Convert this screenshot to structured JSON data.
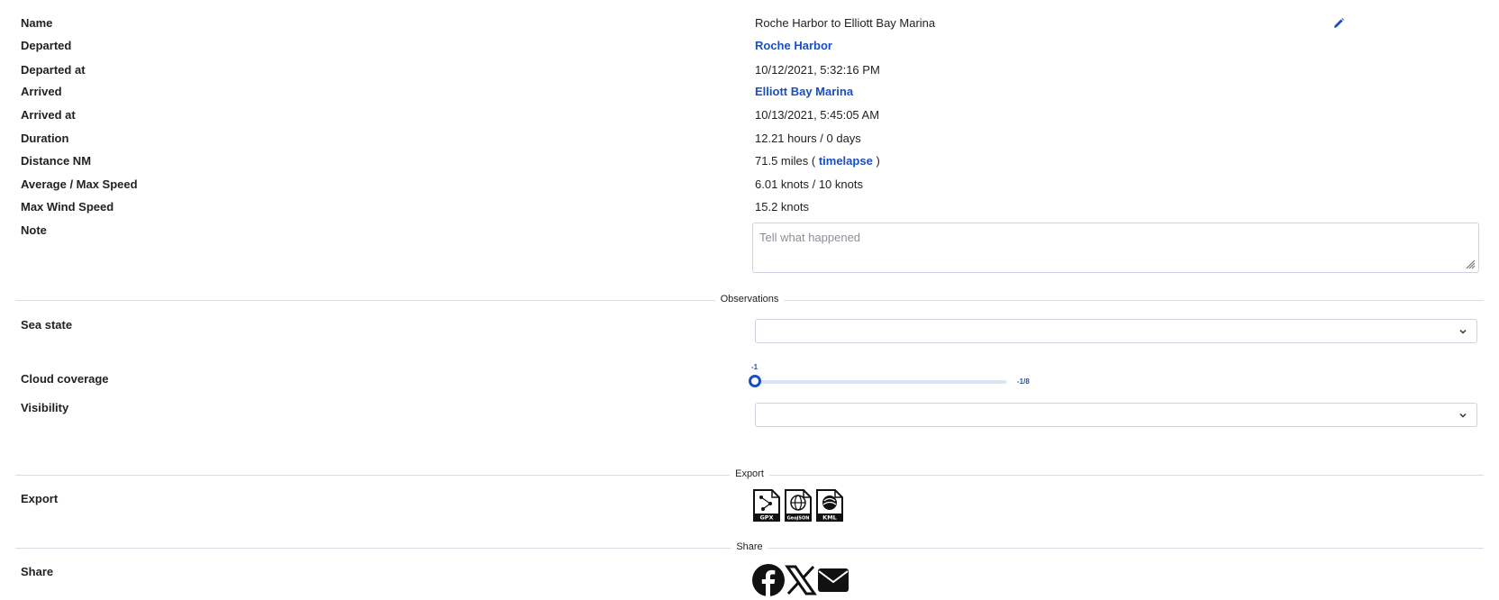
{
  "details": {
    "name_label": "Name",
    "name_value": "Roche Harbor to Elliott Bay Marina",
    "departed_label": "Departed",
    "departed_value": "Roche Harbor",
    "departed_at_label": "Departed at",
    "departed_at_value": "10/12/2021, 5:32:16 PM",
    "arrived_label": "Arrived",
    "arrived_value": "Elliott Bay Marina",
    "arrived_at_label": "Arrived at",
    "arrived_at_value": "10/13/2021, 5:45:05 AM",
    "duration_label": "Duration",
    "duration_value": "12.21 hours / 0 days",
    "distance_label": "Distance NM",
    "distance_prefix": "71.5 miles (",
    "distance_link": "timelapse",
    "distance_suffix": ")",
    "speed_label": "Average / Max Speed",
    "speed_value": "6.01 knots / 10 knots",
    "wind_label": "Max Wind Speed",
    "wind_value": "15.2 knots",
    "note_label": "Note",
    "note_placeholder": "Tell what happened"
  },
  "observations": {
    "section_title": "Observations",
    "sea_state_label": "Sea state",
    "sea_state_value": "",
    "cloud_label": "Cloud coverage",
    "cloud_min": "-1",
    "cloud_max": "-1/8",
    "cloud_level_fraction": 0,
    "visibility_label": "Visibility",
    "visibility_value": ""
  },
  "export": {
    "section_title": "Export",
    "label": "Export",
    "formats": [
      "GPX",
      "GeoJSON",
      "KML"
    ]
  },
  "share": {
    "section_title": "Share",
    "label": "Share",
    "targets": [
      "facebook",
      "x",
      "email"
    ]
  },
  "colors": {
    "accent": "#1a4fc4",
    "divider": "#d9dde6",
    "border": "#cdd3e0"
  }
}
